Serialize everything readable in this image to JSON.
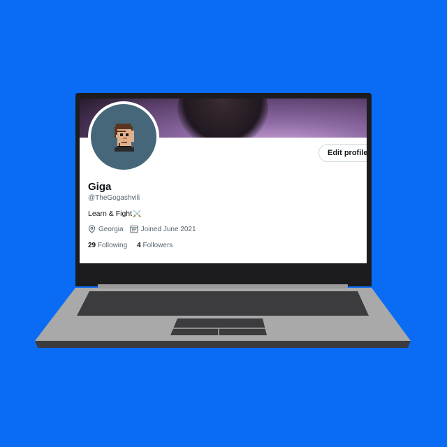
{
  "profile": {
    "name": "Giga",
    "handle": "@TheGogashvili",
    "bio": "Learn & Fight",
    "bio_emoji": "⚔️",
    "location": "Georgia",
    "joined": "Joined June 2021",
    "following_count": "29",
    "following_label": "Following",
    "followers_count": "4",
    "followers_label": "Followers",
    "edit_button": "Edit profile"
  },
  "icons": {
    "location": "location-pin-icon",
    "calendar": "calendar-icon"
  },
  "colors": {
    "background": "#0a6cf5",
    "avatar_bg": "#466779",
    "text_primary": "#0f1419",
    "text_secondary": "#536471"
  }
}
